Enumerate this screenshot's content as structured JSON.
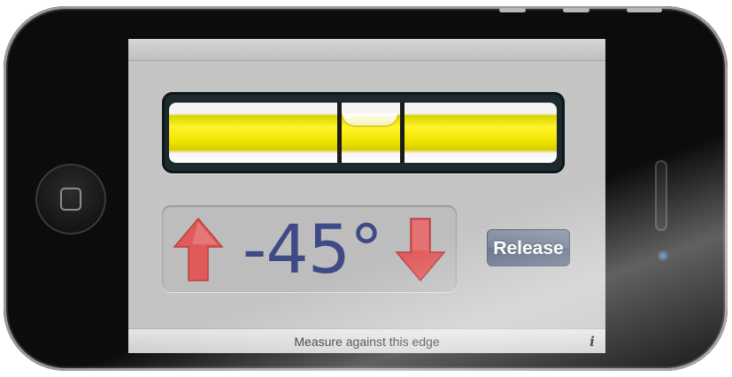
{
  "app": {
    "angle_display": "-45°",
    "release_button_label": "Release",
    "bottom_bar_label": "Measure against this edge"
  },
  "icons": {
    "up_arrow": "arrow-up-icon",
    "down_arrow": "arrow-down-icon",
    "info": "info-icon",
    "home": "home-button-icon"
  },
  "colors": {
    "arrow_red": "#e05a5a",
    "angle_text": "#3f4a86",
    "vial_yellow": "#fff32a",
    "button_blue_gray": "#6d7890"
  },
  "labels": {
    "info_glyph": "i"
  }
}
